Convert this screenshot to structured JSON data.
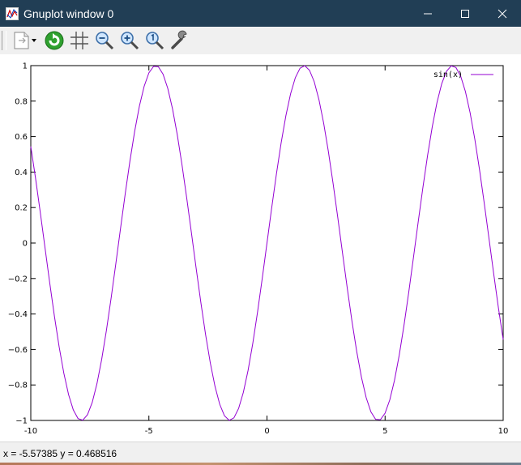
{
  "window": {
    "title": "Gnuplot window 0",
    "controls": [
      "minimize",
      "maximize",
      "close"
    ]
  },
  "toolbar": {
    "items": [
      {
        "name": "copy-to-clipboard-icon"
      },
      {
        "name": "replot-icon"
      },
      {
        "name": "grid-icon"
      },
      {
        "name": "zoom-out-icon"
      },
      {
        "name": "zoom-in-icon"
      },
      {
        "name": "zoom-reset-icon"
      },
      {
        "name": "options-wrench-icon"
      }
    ]
  },
  "status": {
    "text": "x = -5.57385 y = 0.468516"
  },
  "colors": {
    "titlebar": "#213e55",
    "curve": "#9400d3",
    "frame": "#000000"
  },
  "chart_data": {
    "type": "line",
    "function": "sin(x)",
    "series": [
      {
        "name": "sin(x)",
        "expression": "sin(x)",
        "color": "#9400d3"
      }
    ],
    "xlim": [
      -10,
      10
    ],
    "ylim": [
      -1,
      1
    ],
    "x_ticks": [
      -10,
      -5,
      0,
      5,
      10
    ],
    "x_tick_labels": [
      "-10",
      "-5",
      "0",
      "5",
      "10"
    ],
    "y_ticks": [
      -1,
      -0.8,
      -0.6,
      -0.4,
      -0.2,
      0,
      0.2,
      0.4,
      0.6,
      0.8,
      1
    ],
    "y_tick_labels": [
      "−1",
      "−0.8",
      "−0.6",
      "−0.4",
      "−0.2",
      "0",
      "0.2",
      "0.4",
      "0.6",
      "0.8",
      "1"
    ],
    "legend": {
      "label": "sin(x)",
      "position": "top-right"
    },
    "grid": false,
    "title": "",
    "xlabel": "",
    "ylabel": ""
  }
}
